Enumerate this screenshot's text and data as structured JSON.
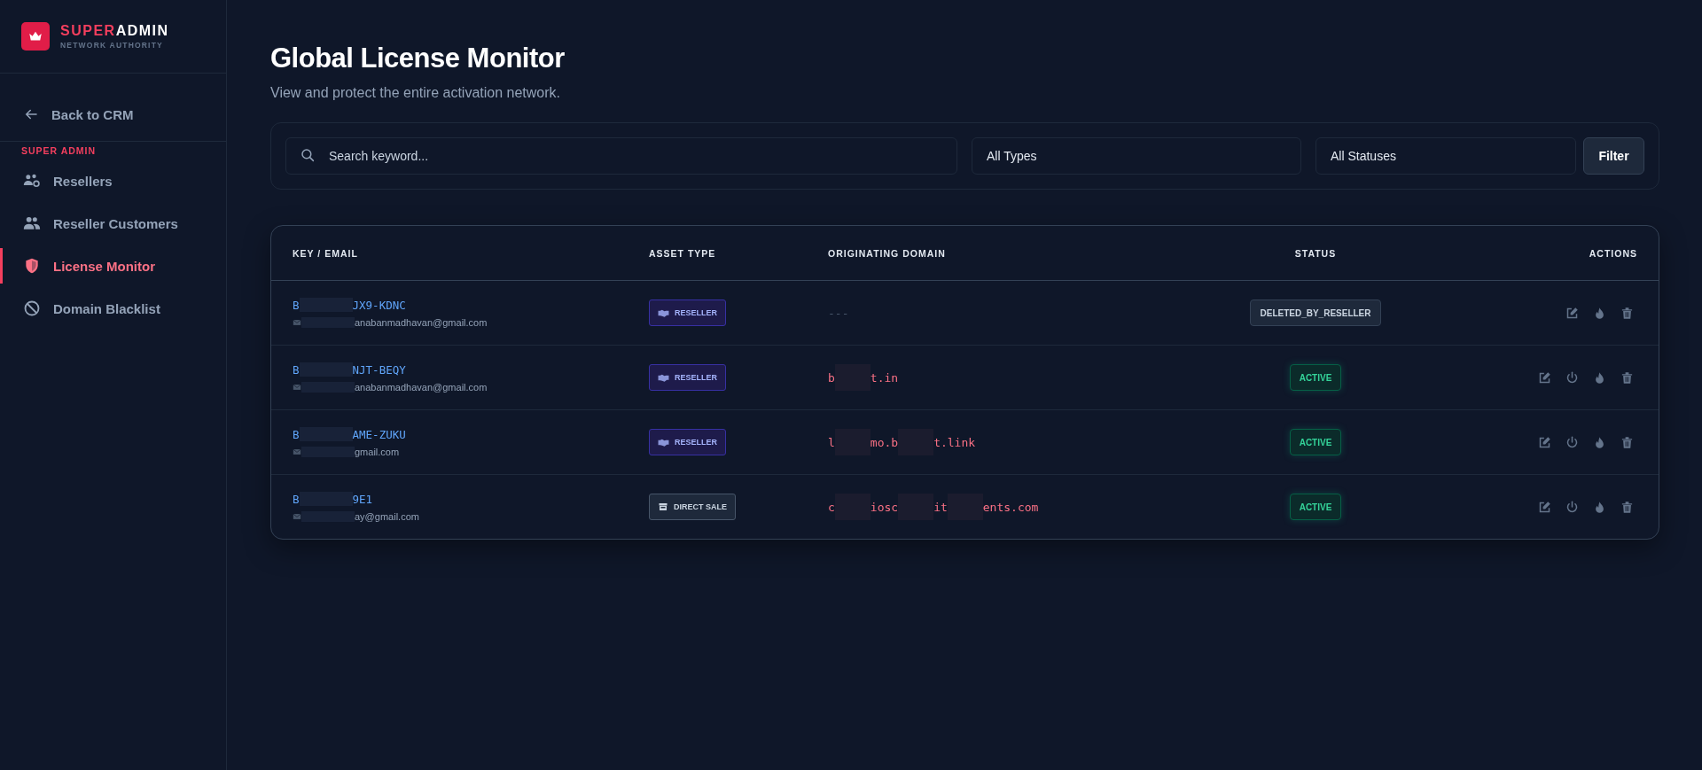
{
  "brand": {
    "name_accent": "SUPER",
    "name_rest": "ADMIN",
    "tagline": "NETWORK AUTHORITY"
  },
  "sidebar": {
    "back_link": "Back to CRM",
    "section_label": "SUPER ADMIN",
    "items": [
      {
        "label": "Resellers",
        "selected": false
      },
      {
        "label": "Reseller Customers",
        "selected": false
      },
      {
        "label": "License Monitor",
        "selected": true
      },
      {
        "label": "Domain Blacklist",
        "selected": false
      }
    ]
  },
  "page": {
    "title": "Global License Monitor",
    "subtitle": "View and protect the entire activation network."
  },
  "filters": {
    "search": {
      "placeholder": "Search keyword..."
    },
    "type_select": "All Types",
    "status_select": "All Statuses",
    "button": "Filter"
  },
  "table": {
    "columns": [
      "KEY / EMAIL",
      "ASSET TYPE",
      "ORIGINATING DOMAIN",
      "STATUS",
      "ACTIONS"
    ],
    "rows": [
      {
        "key_parts": [
          "B",
          "JX9-KDNC"
        ],
        "email": "anabanmadhavan@gmail.com",
        "asset": {
          "kind": "reseller",
          "label": "RESELLER"
        },
        "domain_parts": [
          "---"
        ],
        "status": {
          "kind": "deleted",
          "label": "DELETED_BY_RESELLER"
        },
        "actions": [
          {
            "kind": "edit"
          },
          {
            "kind": "burn"
          },
          {
            "kind": "delete"
          }
        ]
      },
      {
        "key_parts": [
          "B",
          "NJT-BEQY"
        ],
        "email": "anabanmadhavan@gmail.com",
        "asset": {
          "kind": "reseller",
          "label": "RESELLER"
        },
        "domain_parts": [
          "b",
          "t.in"
        ],
        "status": {
          "kind": "active",
          "label": "ACTIVE"
        },
        "actions": [
          {
            "kind": "edit"
          },
          {
            "kind": "power"
          },
          {
            "kind": "burn"
          },
          {
            "kind": "delete"
          }
        ]
      },
      {
        "key_parts": [
          "B",
          "AME-ZUKU"
        ],
        "email": "gmail.com",
        "asset": {
          "kind": "reseller",
          "label": "RESELLER"
        },
        "domain_parts": [
          "l",
          "mo.b",
          "t.link"
        ],
        "status": {
          "kind": "active",
          "label": "ACTIVE"
        },
        "actions": [
          {
            "kind": "edit"
          },
          {
            "kind": "power"
          },
          {
            "kind": "burn"
          },
          {
            "kind": "delete"
          }
        ]
      },
      {
        "key_parts": [
          "B",
          "9E1"
        ],
        "email": "ay@gmail.com",
        "asset": {
          "kind": "direct",
          "label": "DIRECT SALE"
        },
        "domain_parts": [
          "c",
          "iosc",
          "it",
          "ents.com"
        ],
        "status": {
          "kind": "active",
          "label": "ACTIVE"
        },
        "actions": [
          {
            "kind": "edit"
          },
          {
            "kind": "power"
          },
          {
            "kind": "burn"
          },
          {
            "kind": "delete"
          }
        ]
      }
    ]
  }
}
